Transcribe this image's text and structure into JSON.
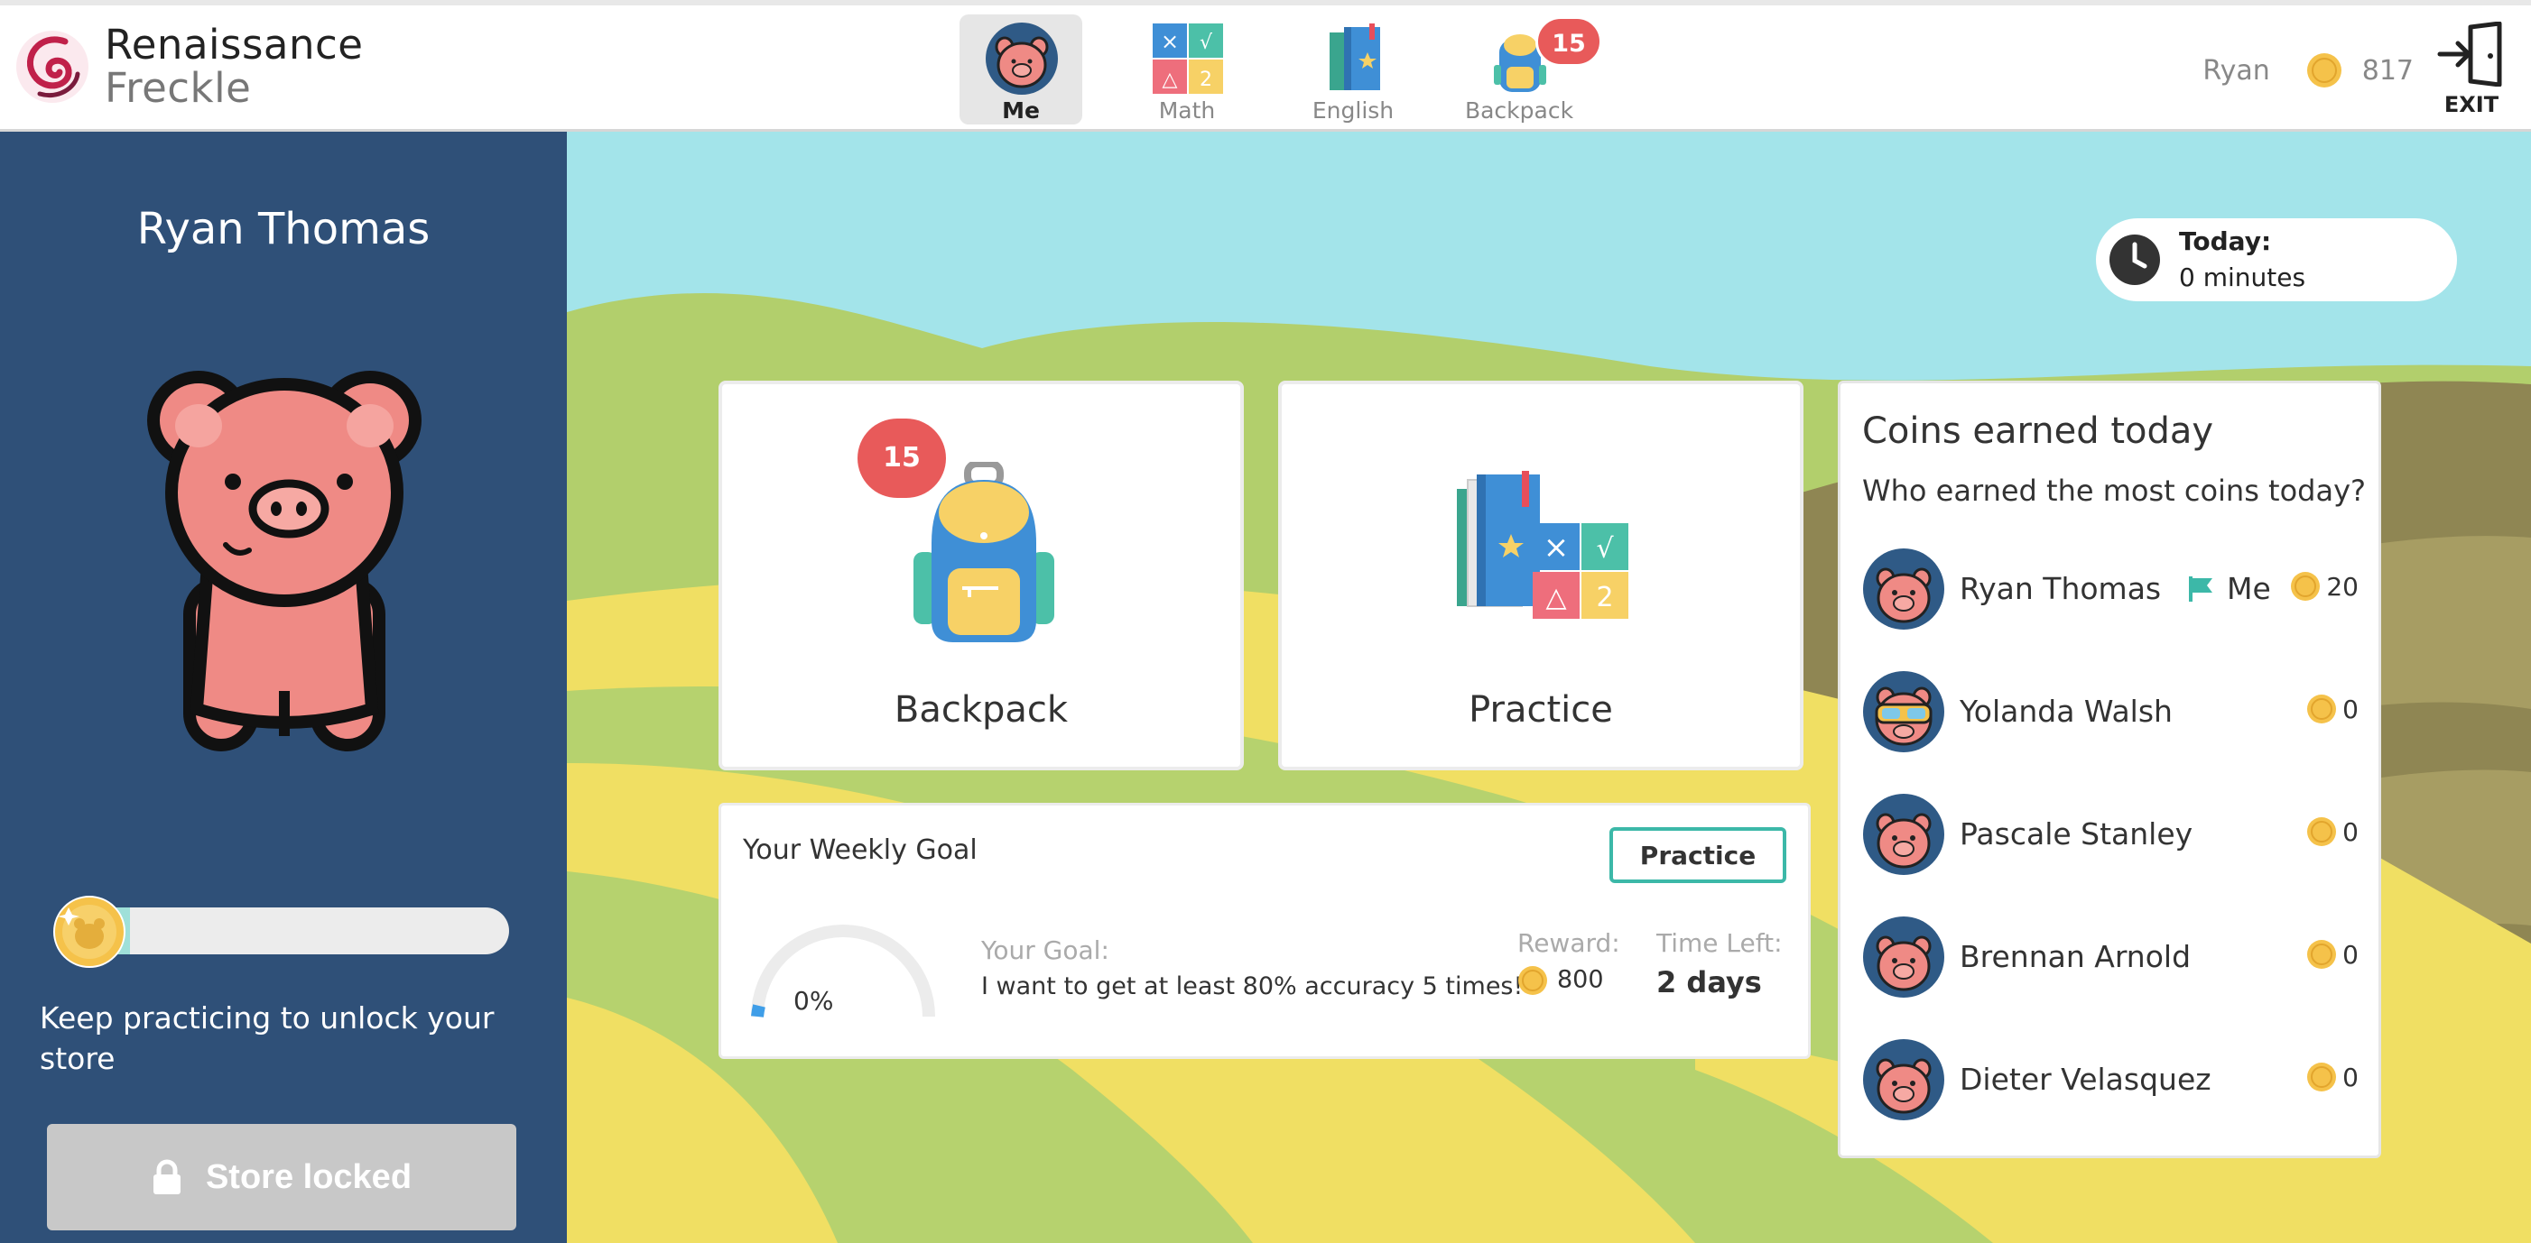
{
  "brand": {
    "line1": "Renaissance",
    "line2": "Freckle"
  },
  "nav": {
    "tabs": [
      {
        "label": "Me",
        "icon": "pig-avatar-icon",
        "active": true
      },
      {
        "label": "Math",
        "icon": "math-icon",
        "active": false
      },
      {
        "label": "English",
        "icon": "book-icon",
        "active": false
      },
      {
        "label": "Backpack",
        "icon": "backpack-icon",
        "active": false,
        "badge": "15"
      }
    ]
  },
  "user": {
    "name": "Ryan",
    "coins": "817"
  },
  "exit_label": "EXIT",
  "sidebar": {
    "full_name": "Ryan Thomas",
    "store_progress": 0.15,
    "message": "Keep practicing to unlock your store",
    "store_button": "Store locked"
  },
  "today": {
    "label": "Today:",
    "value": "0 minutes"
  },
  "cards": {
    "backpack": {
      "label": "Backpack",
      "badge": "15"
    },
    "practice": {
      "label": "Practice"
    }
  },
  "goal": {
    "title": "Your Weekly Goal",
    "button": "Practice",
    "percent": "0%",
    "your_goal_label": "Your Goal:",
    "your_goal_text": "I want to get at least 80% accuracy 5 times!",
    "reward_label": "Reward:",
    "reward_value": "800",
    "time_left_label": "Time Left:",
    "time_left_value": "2 days"
  },
  "leaderboard": {
    "title": "Coins earned today",
    "subtitle": "Who earned the most coins today?",
    "me_label": "Me",
    "rows": [
      {
        "name": "Ryan Thomas",
        "coins": "20",
        "is_me": true,
        "avatar": "pig-avatar-icon"
      },
      {
        "name": "Yolanda Walsh",
        "coins": "0",
        "is_me": false,
        "avatar": "pig-goggles-avatar-icon"
      },
      {
        "name": "Pascale Stanley",
        "coins": "0",
        "is_me": false,
        "avatar": "pig-avatar-icon"
      },
      {
        "name": "Brennan Arnold",
        "coins": "0",
        "is_me": false,
        "avatar": "pig-avatar-icon"
      },
      {
        "name": "Dieter Velasquez",
        "coins": "0",
        "is_me": false,
        "avatar": "pig-avatar-icon"
      }
    ]
  },
  "colors": {
    "sidebar": "#2f5078",
    "accent_teal": "#3cb8a8",
    "badge_red": "#e85a5a",
    "coin_gold": "#f5c24a",
    "sky": "#a3e4ea"
  }
}
